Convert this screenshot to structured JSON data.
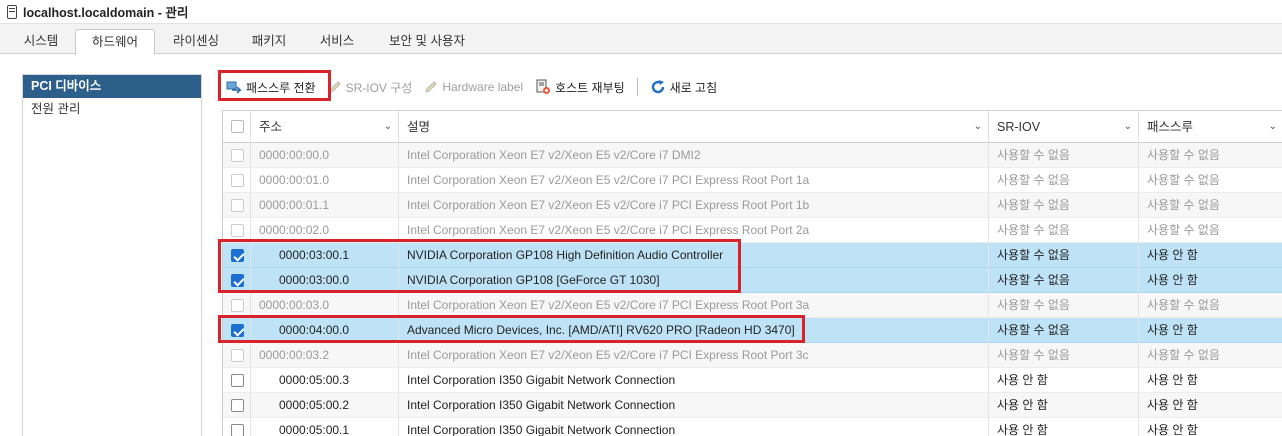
{
  "window": {
    "title": "localhost.localdomain - 관리",
    "icon": "server-icon"
  },
  "tabs": [
    {
      "label": "시스템",
      "active": false
    },
    {
      "label": "하드웨어",
      "active": true
    },
    {
      "label": "라이센싱",
      "active": false
    },
    {
      "label": "패키지",
      "active": false
    },
    {
      "label": "서비스",
      "active": false
    },
    {
      "label": "보안 및 사용자",
      "active": false
    }
  ],
  "sidebar": {
    "items": [
      {
        "label": "PCI 디바이스",
        "active": true
      },
      {
        "label": "전원 관리",
        "active": false
      }
    ]
  },
  "toolbar": {
    "passthrough_label": "패스스루 전환",
    "sriov_label": "SR-IOV 구성",
    "hwlabel_label": "Hardware label",
    "reboot_label": "호스트 재부팅",
    "refresh_label": "새로 고침"
  },
  "table": {
    "headers": {
      "address": "주소",
      "description": "설명",
      "sriov": "SR-IOV",
      "passthrough": "패스스루"
    },
    "rows": [
      {
        "address": "0000:00:00.0",
        "description": "Intel Corporation Xeon E7 v2/Xeon E5 v2/Core i7 DMI2",
        "sriov": "사용할 수 없음",
        "passthrough": "사용할 수 없음",
        "checked": false,
        "enabled": false,
        "selected": false
      },
      {
        "address": "0000:00:01.0",
        "description": "Intel Corporation Xeon E7 v2/Xeon E5 v2/Core i7 PCI Express Root Port 1a",
        "sriov": "사용할 수 없음",
        "passthrough": "사용할 수 없음",
        "checked": false,
        "enabled": false,
        "selected": false
      },
      {
        "address": "0000:00:01.1",
        "description": "Intel Corporation Xeon E7 v2/Xeon E5 v2/Core i7 PCI Express Root Port 1b",
        "sriov": "사용할 수 없음",
        "passthrough": "사용할 수 없음",
        "checked": false,
        "enabled": false,
        "selected": false
      },
      {
        "address": "0000:00:02.0",
        "description": "Intel Corporation Xeon E7 v2/Xeon E5 v2/Core i7 PCI Express Root Port 2a",
        "sriov": "사용할 수 없음",
        "passthrough": "사용할 수 없음",
        "checked": false,
        "enabled": false,
        "selected": false
      },
      {
        "address": "0000:03:00.1",
        "description": "NVIDIA Corporation GP108 High Definition Audio Controller",
        "sriov": "사용할 수 없음",
        "passthrough": "사용 안 함",
        "checked": true,
        "enabled": true,
        "selected": true,
        "indent": true
      },
      {
        "address": "0000:03:00.0",
        "description": "NVIDIA Corporation GP108 [GeForce GT 1030]",
        "sriov": "사용할 수 없음",
        "passthrough": "사용 안 함",
        "checked": true,
        "enabled": true,
        "selected": true,
        "indent": true
      },
      {
        "address": "0000:00:03.0",
        "description": "Intel Corporation Xeon E7 v2/Xeon E5 v2/Core i7 PCI Express Root Port 3a",
        "sriov": "사용할 수 없음",
        "passthrough": "사용할 수 없음",
        "checked": false,
        "enabled": false,
        "selected": false
      },
      {
        "address": "0000:04:00.0",
        "description": "Advanced Micro Devices, Inc. [AMD/ATI] RV620 PRO [Radeon HD 3470]",
        "sriov": "사용할 수 없음",
        "passthrough": "사용 안 함",
        "checked": true,
        "enabled": true,
        "selected": true,
        "indent": true
      },
      {
        "address": "0000:00:03.2",
        "description": "Intel Corporation Xeon E7 v2/Xeon E5 v2/Core i7 PCI Express Root Port 3c",
        "sriov": "사용할 수 없음",
        "passthrough": "사용할 수 없음",
        "checked": false,
        "enabled": false,
        "selected": false
      },
      {
        "address": "0000:05:00.3",
        "description": "Intel Corporation I350 Gigabit Network Connection",
        "sriov": "사용 안 함",
        "passthrough": "사용 안 함",
        "checked": false,
        "enabled": true,
        "selected": false,
        "indent": true
      },
      {
        "address": "0000:05:00.2",
        "description": "Intel Corporation I350 Gigabit Network Connection",
        "sriov": "사용 안 함",
        "passthrough": "사용 안 함",
        "checked": false,
        "enabled": true,
        "selected": false,
        "indent": true
      },
      {
        "address": "0000:05:00.1",
        "description": "Intel Corporation I350 Gigabit Network Connection",
        "sriov": "사용 안 함",
        "passthrough": "사용 안 함",
        "checked": false,
        "enabled": true,
        "selected": false,
        "indent": true
      }
    ]
  },
  "colors": {
    "highlight": "#d8232a",
    "selected_row": "#bfe3f6",
    "sidebar_active": "#2d5f8b",
    "checkbox": "#1a6fd0"
  }
}
